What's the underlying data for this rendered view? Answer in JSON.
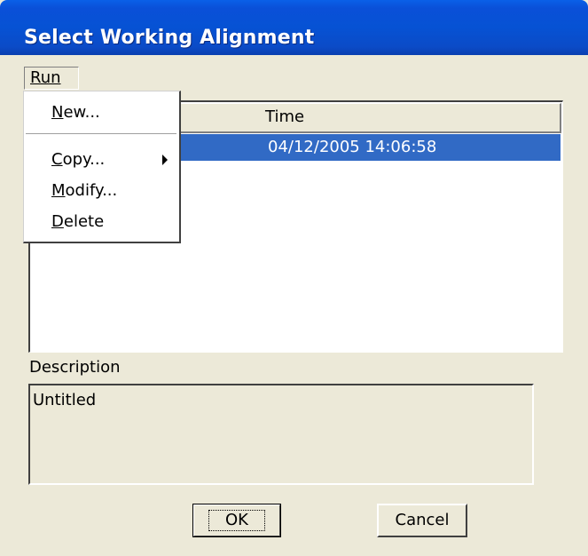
{
  "window": {
    "title": "Select Working Alignment"
  },
  "menubar": {
    "run_label": "Run"
  },
  "list": {
    "columns": [
      "Time"
    ],
    "rows": [
      {
        "time": "04/12/2005 14:06:58",
        "selected": true
      }
    ]
  },
  "description": {
    "label": "Description",
    "value": "Untitled"
  },
  "buttons": {
    "ok": "OK",
    "cancel": "Cancel"
  },
  "run_menu": {
    "items": [
      {
        "label": "New...",
        "has_submenu": false
      },
      {
        "label": "Copy...",
        "has_submenu": true
      },
      {
        "label": "Modify...",
        "has_submenu": false
      },
      {
        "label": "Delete",
        "has_submenu": false
      }
    ]
  },
  "colors": {
    "titlebar": "#0652d4",
    "selection": "#316ac5",
    "face": "#ece9d8"
  }
}
